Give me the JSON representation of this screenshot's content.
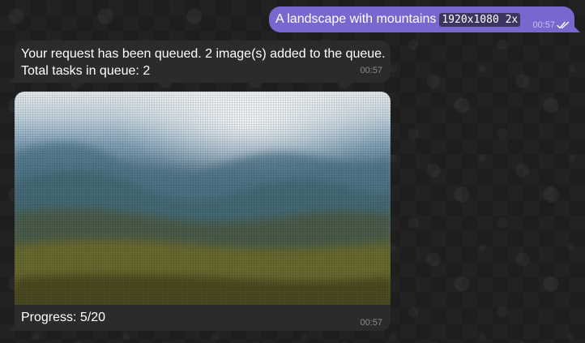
{
  "chat": {
    "messages": [
      {
        "direction": "outgoing",
        "text": "A landscape with mountains",
        "code": "1920x1080 2x",
        "time": "00:57",
        "status_icon": "double-check-icon"
      },
      {
        "direction": "incoming",
        "lines": [
          "Your request has been queued. 2 image(s) added to the queue.",
          "Total tasks in queue: 2"
        ],
        "time": "00:57"
      },
      {
        "direction": "incoming",
        "type": "photo",
        "caption": "Progress: 5/20",
        "progress": {
          "current": 5,
          "total": 20
        },
        "time": "00:57"
      }
    ]
  },
  "colors": {
    "background": "#1e1e1e",
    "outgoing_bubble": "#7a66cf",
    "incoming_bubble": "#2b2b2b",
    "incoming_meta": "#8b8b8b",
    "outgoing_meta": "#c9c2ee"
  }
}
